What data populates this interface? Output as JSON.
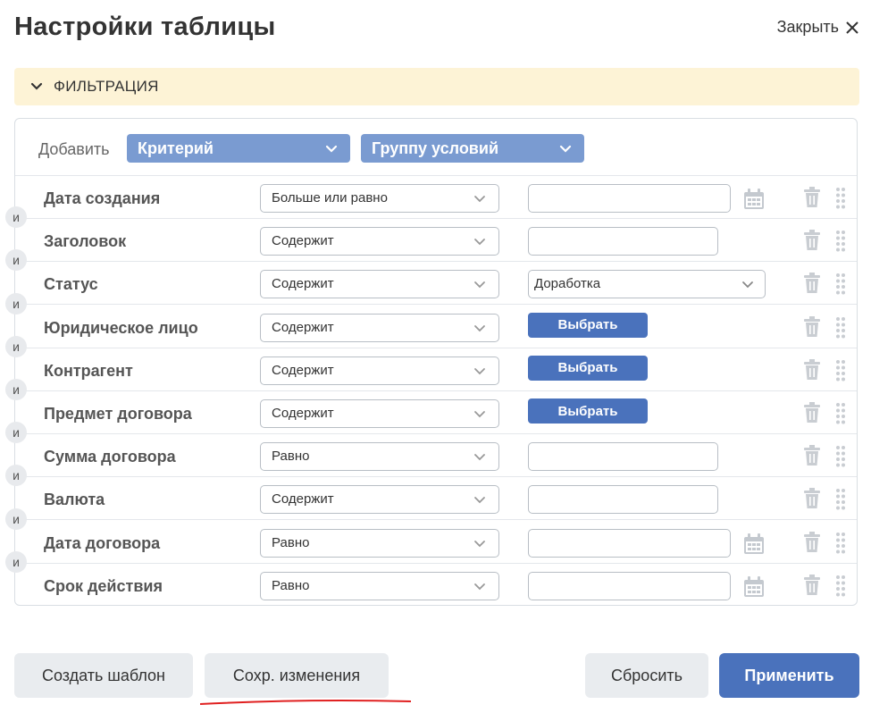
{
  "title": "Настройки таблицы",
  "close_label": "Закрыть",
  "section": {
    "label": "ФИЛЬТРАЦИЯ"
  },
  "add": {
    "label": "Добавить",
    "criterion": "Критерий",
    "group": "Группу условий"
  },
  "and_label": "и",
  "rows": [
    {
      "field": "Дата создания",
      "operator": "Больше или равно",
      "value_type": "date",
      "value": ""
    },
    {
      "field": "Заголовок",
      "operator": "Содержит",
      "value_type": "text",
      "value": ""
    },
    {
      "field": "Статус",
      "operator": "Содержит",
      "value_type": "select",
      "value": "Доработка"
    },
    {
      "field": "Юридическое лицо",
      "operator": "Содержит",
      "value_type": "choose",
      "value": "Выбрать"
    },
    {
      "field": "Контрагент",
      "operator": "Содержит",
      "value_type": "choose",
      "value": "Выбрать"
    },
    {
      "field": "Предмет договора",
      "operator": "Содержит",
      "value_type": "choose",
      "value": "Выбрать"
    },
    {
      "field": "Сумма договора",
      "operator": "Равно",
      "value_type": "text",
      "value": ""
    },
    {
      "field": "Валюта",
      "operator": "Содержит",
      "value_type": "text",
      "value": ""
    },
    {
      "field": "Дата договора",
      "operator": "Равно",
      "value_type": "date",
      "value": ""
    },
    {
      "field": "Срок действия",
      "operator": "Равно",
      "value_type": "date",
      "value": ""
    }
  ],
  "buttons": {
    "create_template": "Создать шаблон",
    "save_changes": "Сохр. изменения",
    "reset": "Сбросить",
    "apply": "Применить"
  },
  "colors": {
    "accent": "#4a72bc",
    "pill": "#7a9bd1",
    "section_bg": "#fdf3d6",
    "annotation_underline": "#e02020"
  },
  "icons": {
    "close": "close-icon",
    "section": "chevron-down-icon",
    "date": "calendar-icon",
    "delete": "trash-icon",
    "drag": "drag-handle-icon"
  }
}
